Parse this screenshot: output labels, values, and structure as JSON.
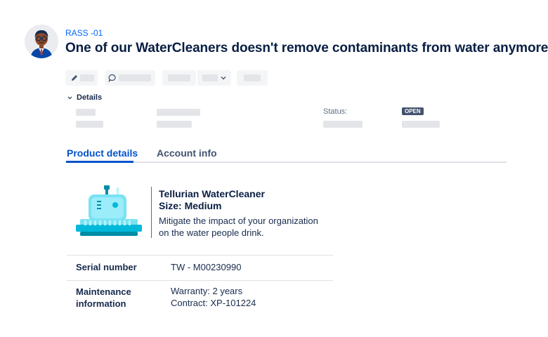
{
  "issue": {
    "key": "RASS -01",
    "summary": "One of our WaterCleaners doesn't remove contaminants from water anymore."
  },
  "toolbar": {
    "icons": [
      "pencil-icon",
      "comment-icon",
      "chevron-down-icon"
    ]
  },
  "details": {
    "heading": "Details",
    "status_label": "Status:",
    "status_value": "OPEN",
    "status_color": "#42526e"
  },
  "tabs": [
    {
      "label": "Product details",
      "active": true
    },
    {
      "label": "Account info",
      "active": false
    }
  ],
  "product": {
    "name": "Tellurian WaterCleaner",
    "size": "Size: Medium",
    "description_line1": "Mitigate the impact of your organization",
    "description_line2": "on the water people drink."
  },
  "table": {
    "rows": [
      {
        "label": "Serial number",
        "value": "TW - M00230990"
      },
      {
        "label_line1": "Maintenance",
        "label_line2": "information",
        "value_line1": "Warranty: 2 years",
        "value_line2": "Contract: XP-101224"
      }
    ]
  },
  "colors": {
    "accent": "#0052cc",
    "link": "#0065ff",
    "text": "#172b4d",
    "placeholder": "#e3e5e8",
    "machine_teal": "#79e2f2",
    "machine_dark": "#008da6"
  }
}
